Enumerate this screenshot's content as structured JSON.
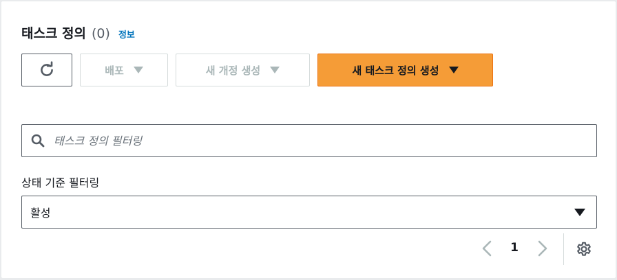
{
  "header": {
    "title": "태스크 정의",
    "count": "(0)",
    "info_link": "정보"
  },
  "toolbar": {
    "refresh_icon": "refresh-icon",
    "deploy_label": "배포",
    "create_revision_label": "새 개정 생성",
    "create_task_def_label": "새 태스크 정의 생성",
    "primary_color": "#f59c37"
  },
  "search": {
    "placeholder": "태스크 정의 필터링",
    "value": ""
  },
  "status_filter": {
    "label": "상태 기준 필터링",
    "selected": "활성"
  },
  "pagination": {
    "current_page": "1"
  }
}
